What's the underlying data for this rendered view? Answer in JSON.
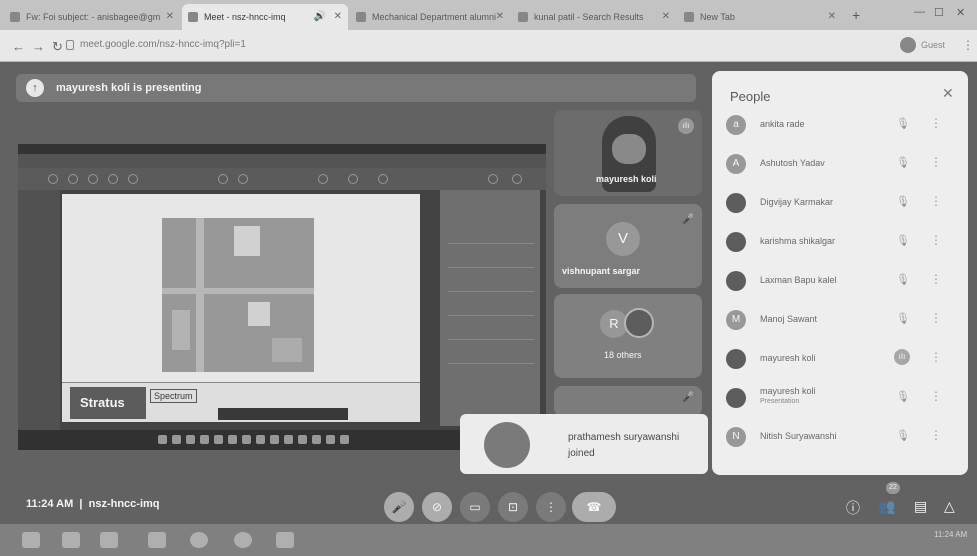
{
  "browser": {
    "tabs": [
      {
        "label": "Fw: Foi subject: - anisbagee@gm"
      },
      {
        "label": "Meet - nsz-hncc-imq"
      },
      {
        "label": "Mechanical Department alumni"
      },
      {
        "label": "kunal patil - Search Results"
      },
      {
        "label": "New Tab"
      }
    ],
    "url": "meet.google.com/nsz-hncc-imq?pli=1",
    "profile_label": "Guest"
  },
  "meet": {
    "presenting_banner": "mayuresh koli is presenting",
    "tiles": [
      {
        "name": "mayuresh koli"
      },
      {
        "name": "vishnupant sargar",
        "initial": "V"
      },
      {
        "name": "18 others",
        "initial": "R"
      }
    ],
    "toast": {
      "name": "prathamesh suryawanshi",
      "status": "joined"
    },
    "meeting_time": "11:24 AM",
    "meeting_code": "nsz-hncc-imq",
    "participant_count": "22"
  },
  "shared_screen": {
    "brand": "Stratus",
    "brand2": "Spectrum"
  },
  "people": {
    "title": "People",
    "list": [
      {
        "name": "ankita rade",
        "initial": "a"
      },
      {
        "name": "Ashutosh Yadav",
        "initial": "A"
      },
      {
        "name": "Digvijay Karmakar",
        "initial": ""
      },
      {
        "name": "karishma shikalgar",
        "initial": ""
      },
      {
        "name": "Laxman Bapu kalel",
        "initial": ""
      },
      {
        "name": "Manoj Sawant",
        "initial": "M"
      },
      {
        "name": "mayuresh koli",
        "initial": ""
      },
      {
        "name": "mayuresh koli",
        "sub": "Presentation",
        "initial": ""
      },
      {
        "name": "Nitish Suryawanshi",
        "initial": "N"
      }
    ]
  },
  "taskbar": {
    "time": "11:24 AM"
  }
}
